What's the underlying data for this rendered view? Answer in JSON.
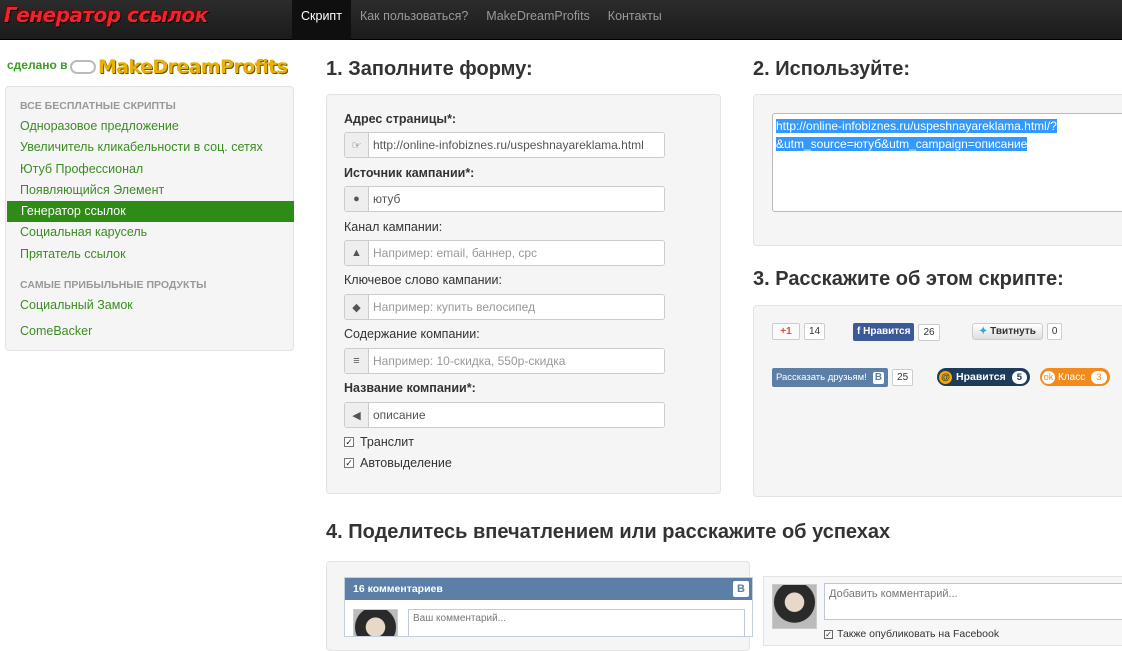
{
  "header": {
    "brand": "Генератор ссылок",
    "nav": [
      "Скрипт",
      "Как пользоваться?",
      "MakeDreamProfits",
      "Контакты"
    ]
  },
  "sidebar": {
    "made_by": "сделано в",
    "logo_text": "MakeDreamProfits",
    "section1_title": "ВСЕ БЕСПЛАТНЫЕ СКРИПТЫ",
    "items1": [
      "Одноразовое предложение",
      "Увеличитель кликабельности в соц. сетях",
      "Ютуб Профессионал",
      "Появляющийся Элемент",
      "Генератор ссылок",
      "Социальная карусель",
      "Прятатель ссылок"
    ],
    "section2_title": "САМЫЕ ПРИБЫЛЬНЫЕ ПРОДУКТЫ",
    "items2": [
      "Социальный Замок",
      "ComeBacker"
    ]
  },
  "form": {
    "heading": "1. Заполните форму:",
    "page_url_label": "Адрес страницы*:",
    "page_url_value": "http://online-infobiznes.ru/uspeshnayareklama.html",
    "source_label": "Источник кампании*:",
    "source_value": "ютуб",
    "medium_label": "Канал кампании:",
    "medium_placeholder": "Например: email, баннер, cpc",
    "term_label": "Ключевое слово кампании:",
    "term_placeholder": "Например: купить велосипед",
    "content_label": "Содержание компании:",
    "content_placeholder": "Например: 10-скидка, 550р-скидка",
    "name_label": "Название компании*:",
    "name_value": "описание",
    "translit_label": "Транслит",
    "autoselect_label": "Автовыделение"
  },
  "use": {
    "heading": "2. Используйте:",
    "line1": "http://online-infobiznes.ru/uspeshnayareklama.html/?",
    "line2": "&utm_source=ютуб&utm_campaign=описание"
  },
  "share": {
    "heading": "3. Расскажите об этом скрипте:",
    "gplus_label": "+1",
    "gplus_count": "14",
    "fb_label": "Нравится",
    "fb_count": "26",
    "tw_label": "Твитнуть",
    "tw_count": "0",
    "vk_label": "Рассказать друзьям!",
    "vk_count": "25",
    "mm_label": "Нравится",
    "mm_count": "5",
    "ok_label": "Класс",
    "ok_count": "3"
  },
  "feedback": {
    "heading": "4. Поделитесь впечатлением или расскажите об успехах",
    "vk_comments_title": "16 комментариев",
    "vk_placeholder": "Ваш комментарий...",
    "fb_placeholder": "Добавить комментарий...",
    "fb_also_post": "Также опубликовать на Facebook"
  }
}
